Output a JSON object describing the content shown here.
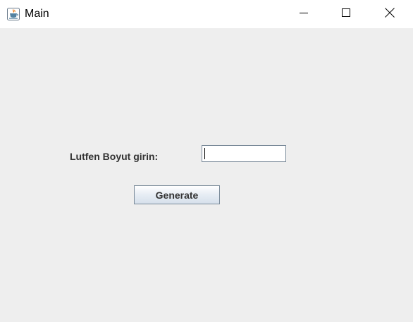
{
  "window": {
    "title": "Main",
    "icon": "java-cup-icon",
    "controls": [
      "minimize",
      "maximize",
      "close"
    ]
  },
  "form": {
    "size_label": "Lutfen Boyut girin:",
    "size_value": "",
    "generate_label": "Generate"
  }
}
